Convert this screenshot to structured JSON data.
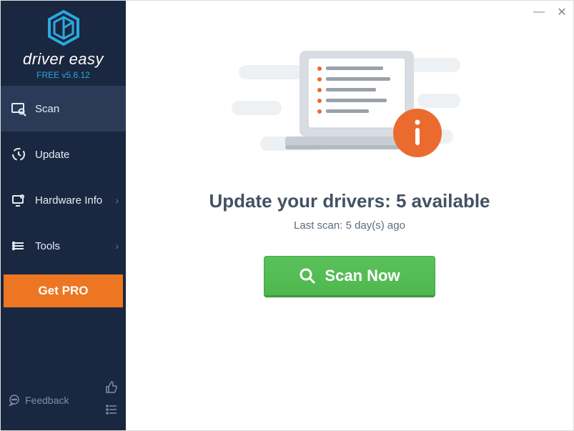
{
  "window": {
    "minimize": "—",
    "close": "✕"
  },
  "brand": {
    "name": "driver easy",
    "version": "FREE v5.6.12"
  },
  "sidebar": {
    "items": [
      {
        "label": "Scan"
      },
      {
        "label": "Update"
      },
      {
        "label": "Hardware Info"
      },
      {
        "label": "Tools"
      }
    ],
    "getpro_label": "Get PRO",
    "feedback_label": "Feedback"
  },
  "main": {
    "headline": "Update your drivers: 5 available",
    "subline": "Last scan: 5 day(s) ago",
    "scan_button": "Scan Now"
  },
  "colors": {
    "brand_accent": "#2aa9e0",
    "sidebar_bg": "#1a2740",
    "sidebar_active": "#2b3a57",
    "getpro": "#ec7621",
    "scan_green": "#4eb84e",
    "info_orange": "#eb6b2f",
    "text_dark": "#445163"
  }
}
